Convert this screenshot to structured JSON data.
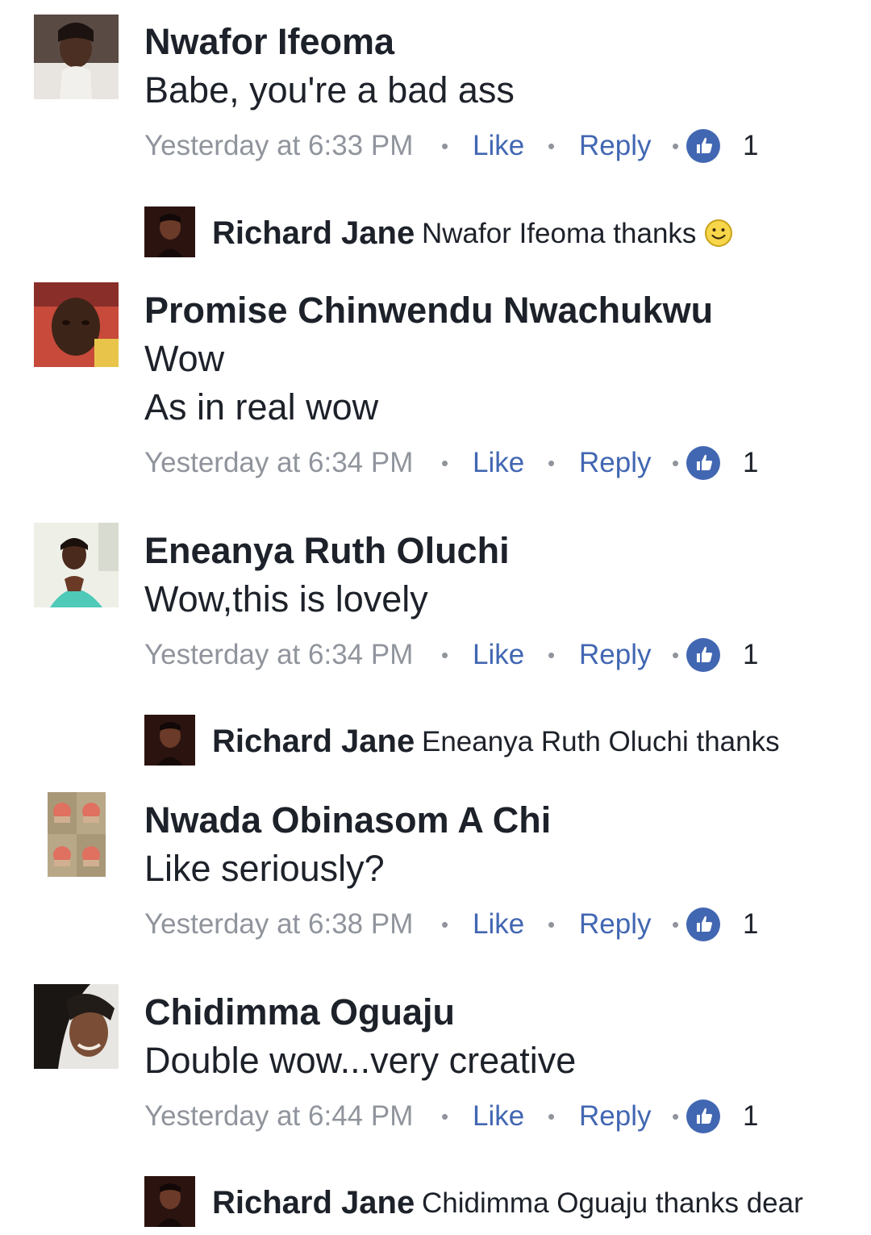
{
  "comments": [
    {
      "author": "Nwafor Ifeoma",
      "lines": [
        "Babe, you're a bad ass"
      ],
      "timestamp": "Yesterday at 6:33 PM",
      "like_label": "Like",
      "reply_label": "Reply",
      "reaction_count": "1",
      "reaction_icon": "thumbs-up-icon",
      "reply": {
        "author": "Richard Jane",
        "text": "Nwafor Ifeoma thanks",
        "emoji": "slightly-smiling-face-icon"
      }
    },
    {
      "author": "Promise Chinwendu Nwachukwu",
      "lines": [
        "Wow",
        "As in real wow"
      ],
      "timestamp": "Yesterday at 6:34 PM",
      "like_label": "Like",
      "reply_label": "Reply",
      "reaction_count": "1",
      "reaction_icon": "thumbs-up-icon"
    },
    {
      "author": "Eneanya Ruth Oluchi",
      "lines": [
        "Wow,this is lovely"
      ],
      "timestamp": "Yesterday at 6:34 PM",
      "like_label": "Like",
      "reply_label": "Reply",
      "reaction_count": "1",
      "reaction_icon": "thumbs-up-icon",
      "reply": {
        "author": "Richard Jane",
        "text": "Eneanya Ruth Oluchi thanks"
      }
    },
    {
      "author": "Nwada Obinasom A Chi",
      "lines": [
        "Like seriously?"
      ],
      "timestamp": "Yesterday at 6:38 PM",
      "like_label": "Like",
      "reply_label": "Reply",
      "reaction_count": "1",
      "reaction_icon": "thumbs-up-icon"
    },
    {
      "author": "Chidimma Oguaju",
      "lines": [
        "Double wow...very creative"
      ],
      "timestamp": "Yesterday at 6:44 PM",
      "like_label": "Like",
      "reply_label": "Reply",
      "reaction_count": "1",
      "reaction_icon": "thumbs-up-icon",
      "reply": {
        "author": "Richard Jane",
        "text": "Chidimma Oguaju thanks dear"
      }
    }
  ],
  "separator": "•",
  "colors": {
    "link": "#4267b2",
    "meta": "#90949c",
    "text": "#1d2129",
    "reaction": "#4267b2"
  }
}
